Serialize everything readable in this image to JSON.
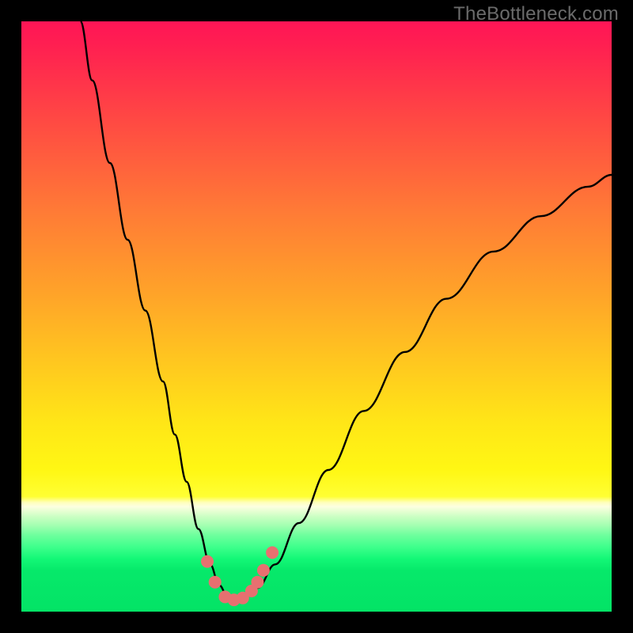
{
  "watermark": "TheBottleneck.com",
  "colors": {
    "frame": "#000000",
    "curve_stroke": "#000000",
    "marker_fill": "#e77070",
    "gradient_top": "#ff1556",
    "gradient_bottom": "#04e366"
  },
  "chart_data": {
    "type": "line",
    "title": "",
    "xlabel": "",
    "ylabel": "",
    "xlim": [
      0,
      100
    ],
    "ylim": [
      0,
      100
    ],
    "grid": false,
    "legend": false,
    "series": [
      {
        "name": "bottleneck-curve",
        "x": [
          10,
          12,
          15,
          18,
          21,
          24,
          26,
          28,
          30,
          32,
          33.5,
          35,
          36.5,
          38,
          40,
          43,
          47,
          52,
          58,
          65,
          72,
          80,
          88,
          96,
          100
        ],
        "y": [
          100,
          90,
          76,
          63,
          51,
          39,
          30,
          22,
          14,
          8,
          4.5,
          2.5,
          2,
          2.5,
          4,
          8,
          15,
          24,
          34,
          44,
          53,
          61,
          67,
          72,
          74
        ]
      }
    ],
    "markers": {
      "name": "salient-points",
      "x": [
        31.5,
        32.8,
        34.5,
        36,
        37.5,
        39,
        40,
        41,
        42.5
      ],
      "y": [
        8.5,
        5,
        2.5,
        2,
        2.3,
        3.5,
        5,
        7,
        10
      ]
    }
  }
}
